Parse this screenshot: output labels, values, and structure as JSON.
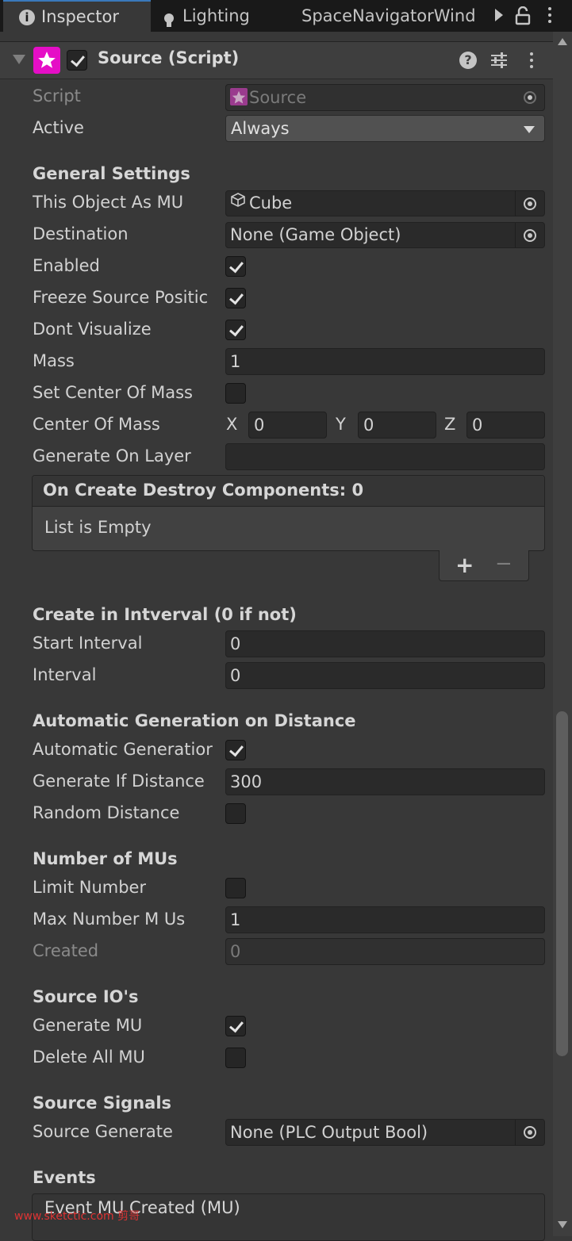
{
  "tabs": [
    {
      "label": "Inspector",
      "icon": "info-icon"
    },
    {
      "label": "Lighting",
      "icon": "bulb-icon"
    },
    {
      "label": "SpaceNavigatorWind",
      "icon": ""
    }
  ],
  "component": {
    "title": "Source (Script)",
    "enabled": true
  },
  "fields": {
    "script_label": "Script",
    "script_value": "Source",
    "active_label": "Active",
    "active_value": "Always",
    "general_header": "General Settings",
    "this_object_label": "This Object As MU",
    "this_object_value": "Cube",
    "destination_label": "Destination",
    "destination_value": "None (Game Object)",
    "enabled_label": "Enabled",
    "freeze_label": "Freeze Source Positic",
    "dont_vis_label": "Dont Visualize",
    "mass_label": "Mass",
    "mass_value": "1",
    "set_com_label": "Set Center Of Mass",
    "com_label": "Center Of Mass",
    "com_x_label": "X",
    "com_x": "0",
    "com_y_label": "Y",
    "com_y": "0",
    "com_z_label": "Z",
    "com_z": "0",
    "gen_layer_label": "Generate On Layer",
    "gen_layer_value": "",
    "list_title": "On Create Destroy Components: 0",
    "list_empty": "List is Empty",
    "list_add": "+",
    "list_remove": "−",
    "interval_header": "Create in Intverval (0 if not)",
    "start_interval_label": "Start Interval",
    "start_interval_value": "0",
    "interval_label": "Interval",
    "interval_value": "0",
    "auto_header": "Automatic Generation on Distance",
    "auto_gen_label": "Automatic Generatior",
    "gen_if_dist_label": "Generate If Distance",
    "gen_if_dist_value": "300",
    "random_dist_label": "Random Distance",
    "num_header": "Number of MUs",
    "limit_label": "Limit Number",
    "max_num_label": "Max Number M Us",
    "max_num_value": "1",
    "created_label": "Created",
    "created_value": "0",
    "io_header": "Source IO's",
    "gen_mu_label": "Generate MU",
    "delete_all_label": "Delete All MU",
    "signals_header": "Source Signals",
    "source_gen_label": "Source Generate",
    "source_gen_value": "None (PLC Output Bool)",
    "events_header": "Events",
    "event_title": "Event MU Created (MU)"
  },
  "checks": {
    "enabled": true,
    "freeze": true,
    "dont_visualize": true,
    "set_center_of_mass": false,
    "automatic_generation": true,
    "random_distance": false,
    "limit_number": false,
    "generate_mu": true,
    "delete_all_mu": false
  },
  "watermark": "www.sketctic.com 剪哥",
  "colors": {
    "background": "#383838",
    "field": "#2a2a2a",
    "accent": "#3a79bb",
    "script_icon": "#e50ec6"
  }
}
